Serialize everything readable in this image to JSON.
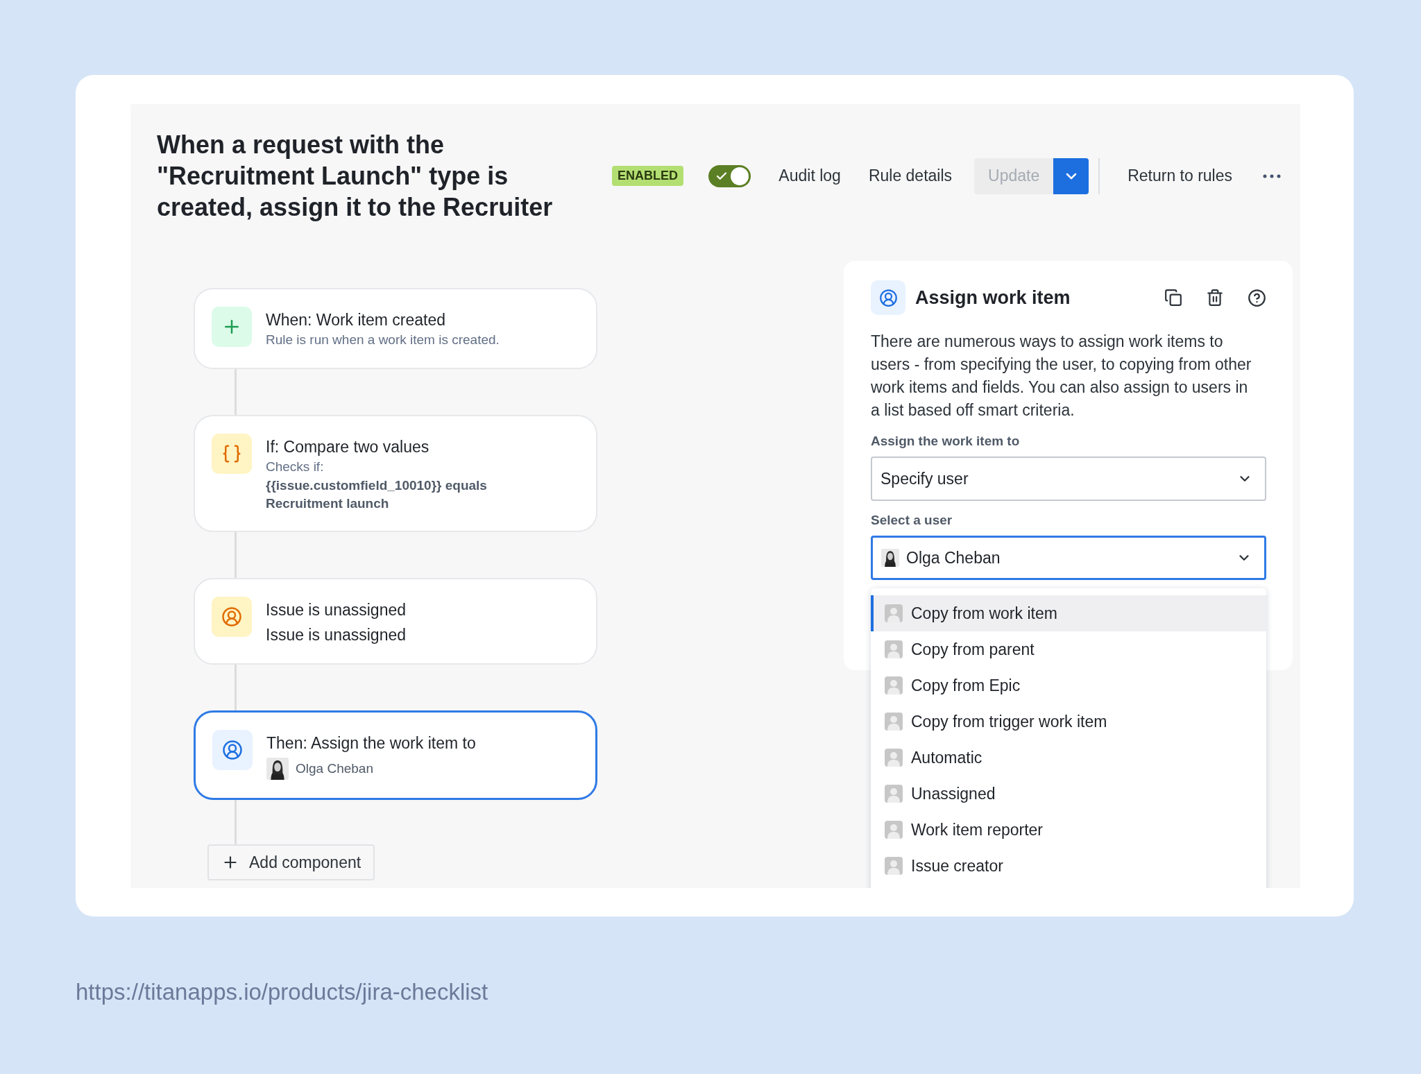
{
  "header": {
    "title": "When a request with the \"Recruitment Launch\" type is created, assign it to the Recruiter",
    "status_badge": "ENABLED",
    "toggle": {
      "on": true
    },
    "links": [
      "Audit log",
      "Rule details"
    ],
    "update_button": {
      "label": "Update",
      "disabled": true
    },
    "return_link": "Return to rules"
  },
  "flow": {
    "components": [
      {
        "kind": "trigger",
        "title": "When: Work item created",
        "subtitle": "Rule is run when a work item is created.",
        "selected": false
      },
      {
        "kind": "condition",
        "title": "If: Compare two values",
        "subtitle": "Checks if:",
        "detail": "{{issue.customfield_10010}} equals Recruitment launch",
        "selected": false
      },
      {
        "kind": "user_condition",
        "title": "Issue is unassigned",
        "subtitle": "Issue is unassigned",
        "selected": false
      },
      {
        "kind": "action",
        "title": "Then: Assign the work item to",
        "user": "Olga Cheban",
        "selected": true
      }
    ],
    "add_button": "Add component"
  },
  "panel": {
    "title": "Assign work item",
    "description": "There are numerous ways to assign work items to users - from specifying the user, to copying from other work items and fields. You can also assign to users in a list based off smart criteria.",
    "fields": [
      {
        "label": "Assign the work item to",
        "value": "Specify user",
        "focused": false,
        "avatar": false
      },
      {
        "label": "Select a user",
        "value": "Olga Cheban",
        "focused": true,
        "avatar": true
      }
    ],
    "dropdown": {
      "options": [
        {
          "label": "Copy from work item",
          "selected": true
        },
        {
          "label": "Copy from parent",
          "selected": false
        },
        {
          "label": "Copy from Epic",
          "selected": false
        },
        {
          "label": "Copy from trigger work item",
          "selected": false
        },
        {
          "label": "Automatic",
          "selected": false
        },
        {
          "label": "Unassigned",
          "selected": false
        },
        {
          "label": "Work item reporter",
          "selected": false
        },
        {
          "label": "Issue creator",
          "selected": false
        }
      ]
    }
  },
  "source_url": "https://titanapps.io/products/jira-checklist"
}
